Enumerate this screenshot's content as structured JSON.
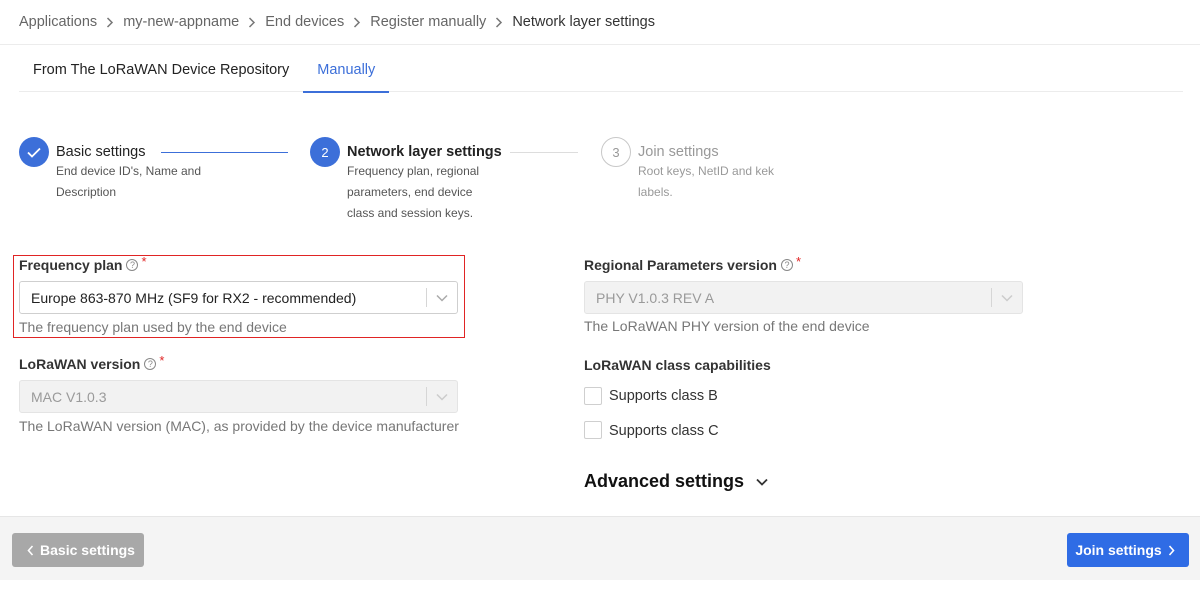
{
  "breadcrumb": {
    "items": [
      "Applications",
      "my-new-appname",
      "End devices",
      "Register manually",
      "Network layer settings"
    ]
  },
  "tabs": [
    {
      "label": "From The LoRaWAN Device Repository",
      "active": false
    },
    {
      "label": "Manually",
      "active": true
    }
  ],
  "steps": [
    {
      "number": "",
      "title": "Basic settings",
      "desc_lines": [
        "End device ID's, Name and",
        "Description"
      ],
      "state": "done"
    },
    {
      "number": "2",
      "title": "Network layer settings",
      "desc_lines": [
        "Frequency plan, regional",
        "parameters, end device",
        "class and session keys."
      ],
      "state": "active"
    },
    {
      "number": "3",
      "title": "Join settings",
      "desc_lines": [
        "Root keys, NetID and kek",
        "labels."
      ],
      "state": "pending"
    }
  ],
  "form": {
    "frequency_plan": {
      "label": "Frequency plan",
      "value": "Europe 863-870 MHz (SF9 for RX2 - recommended)",
      "hint": "The frequency plan used by the end device"
    },
    "lorawan_version": {
      "label": "LoRaWAN version",
      "value": "MAC V1.0.3",
      "hint": "The LoRaWAN version (MAC), as provided by the device manufacturer"
    },
    "regional_params": {
      "label": "Regional Parameters version",
      "value": "PHY V1.0.3 REV A",
      "hint": "The LoRaWAN PHY version of the end device"
    },
    "class_capabilities": {
      "label": "LoRaWAN class capabilities",
      "options": [
        "Supports class B",
        "Supports class C"
      ]
    },
    "advanced_label": "Advanced settings"
  },
  "footer": {
    "back_label": "Basic settings",
    "next_label": "Join settings"
  },
  "colors": {
    "accent": "#3c6fd9",
    "primary_button": "#2f6ce5",
    "required": "#e02424"
  }
}
